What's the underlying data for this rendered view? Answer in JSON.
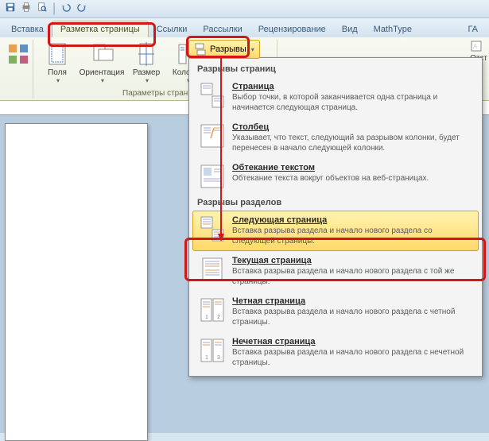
{
  "qat": {
    "sep": "|"
  },
  "tabs": {
    "insert": "Вставка",
    "layout": "Разметка страницы",
    "refs": "Ссылки",
    "mail": "Рассылки",
    "review": "Рецензирование",
    "view": "Вид",
    "mathtype": "MathType",
    "end": "ГА"
  },
  "ribbon": {
    "margins": "Поля",
    "orientation": "Ориентация",
    "size": "Размер",
    "columns": "Колонки",
    "page_setup_label": "Параметры стран",
    "indent_label": "Отст"
  },
  "breaks": {
    "label": "Разрывы"
  },
  "dropdown": {
    "sec1": "Разрывы страниц",
    "i1": {
      "t": "Страница",
      "d": "Выбор точки, в которой заканчивается одна страница и начинается следующая страница."
    },
    "i2": {
      "t": "Столбец",
      "d": "Указывает, что текст, следующий за разрывом колонки, будет перенесен в начало следующей колонки."
    },
    "i3": {
      "t": "Обтекание текстом",
      "d": "Обтекание текста вокруг объектов на веб-страницах."
    },
    "sec2": "Разрывы разделов",
    "i4": {
      "t": "Следующая страница",
      "d": "Вставка разрыва раздела и начало нового раздела со следующей страницы."
    },
    "i5": {
      "t": "Текущая страница",
      "d": "Вставка разрыва раздела и начало нового раздела с той же страницы."
    },
    "i6": {
      "t": "Четная страница",
      "d": "Вставка разрыва раздела и начало нового раздела с четной страницы."
    },
    "i7": {
      "t": "Нечетная страница",
      "d": "Вставка разрыва раздела и начало нового раздела с нечетной страницы."
    }
  }
}
